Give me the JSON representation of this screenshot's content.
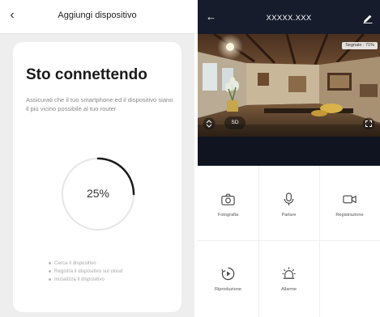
{
  "setup_screen": {
    "header_title": "Aggiungi dispositivo",
    "heading": "Sto connettendo",
    "description": "Assicurati che il tuo smartphone ed il dispositivo siano il più vicino possibile al tuo router",
    "progress_text": "25%",
    "progress": 0.25,
    "steps": [
      "Cerca il dispositivo",
      "Registra il dispositivo sul cloud",
      "Inizializza il dispositivo"
    ],
    "accent_color": "#1a1a1a"
  },
  "camera_screen": {
    "header_title": "XXXXX.XXX",
    "signal_text": "Segnale : 71%",
    "quality_badge": "SD",
    "features": [
      {
        "label": "Fotografia",
        "icon": "camera-icon"
      },
      {
        "label": "Parlare",
        "icon": "microphone-icon"
      },
      {
        "label": "Registrazione",
        "icon": "video-camera-icon"
      },
      {
        "label": "Riproduzione",
        "icon": "playback-icon"
      },
      {
        "label": "Allarme",
        "icon": "alarm-light-icon"
      }
    ],
    "header_color": "#161c2b"
  }
}
